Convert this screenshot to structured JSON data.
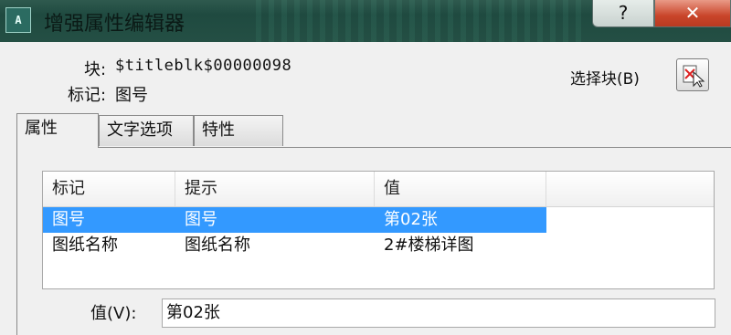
{
  "window": {
    "title": "增强属性编辑器",
    "app_icon_text": "A",
    "help_label": "?",
    "close_label": "✕"
  },
  "header": {
    "block_label": "块:",
    "block_value": "$titleblk$00000098",
    "tag_label": "标记:",
    "tag_value": "图号",
    "select_block_label": "选择块(B)"
  },
  "tabs": [
    {
      "label": "属性",
      "active": true
    },
    {
      "label": "文字选项",
      "active": false
    },
    {
      "label": "特性",
      "active": false
    }
  ],
  "table": {
    "columns": [
      "标记",
      "提示",
      "值",
      ""
    ],
    "rows": [
      {
        "tag": "图号",
        "prompt": "图号",
        "value": "第02张",
        "selected": true
      },
      {
        "tag": "图纸名称",
        "prompt": "图纸名称",
        "value": "2#楼梯详图",
        "selected": false
      }
    ]
  },
  "value_field": {
    "label": "值(V):",
    "value": "第02张"
  },
  "colors": {
    "selection": "#3399ff",
    "close_button": "#c9452a"
  }
}
